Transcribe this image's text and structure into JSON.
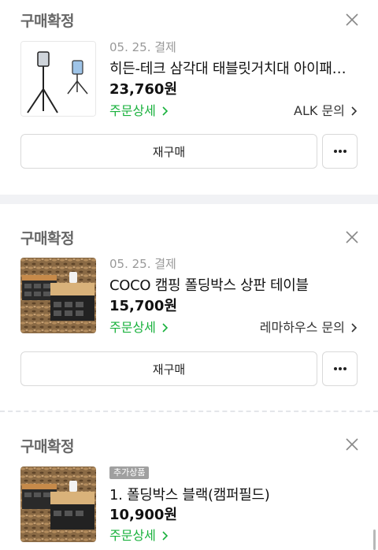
{
  "orders": [
    {
      "status": "구매확정",
      "date": "05. 25. 결제",
      "product_name": "히든-테크 삼각대 태블릿거치대 아이패드 거치대",
      "price": "23,760원",
      "detail_link": "주문상세",
      "seller_inquiry": "ALK 문의",
      "rebuy_label": "재구매"
    },
    {
      "status": "구매확정",
      "date": "05. 25. 결제",
      "product_name": "COCO 캠핑 폴딩박스 상판 테이블",
      "price": "15,700원",
      "detail_link": "주문상세",
      "seller_inquiry": "레마하우스 문의",
      "rebuy_label": "재구매"
    },
    {
      "status": "구매확정",
      "badge": "추가상품",
      "product_name": "1. 폴딩박스 블랙(캠퍼필드)",
      "price": "10,900원",
      "detail_link": "주문상세"
    }
  ],
  "icons": {
    "close": "close-icon",
    "more": "more-dots-icon",
    "chevron": "chevron-right-icon"
  },
  "colors": {
    "detail_link": "#18b13c",
    "status": "#666666",
    "badge": "#a0a0a0"
  }
}
